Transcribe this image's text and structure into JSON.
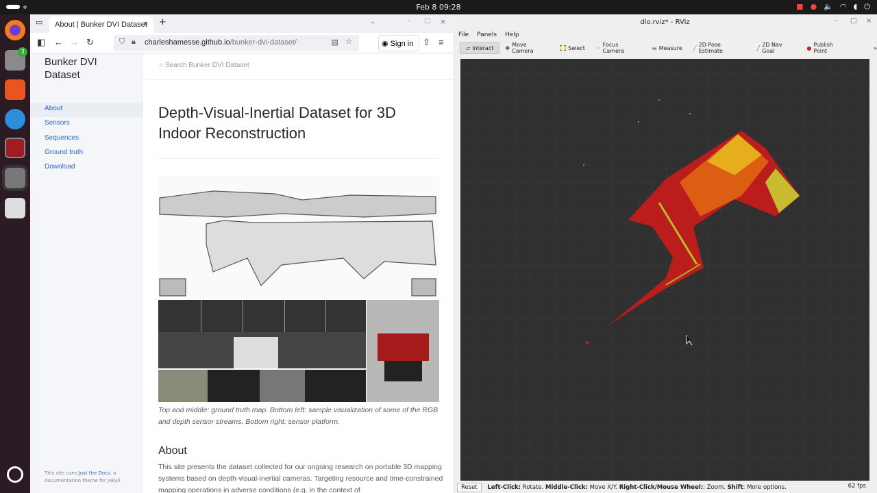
{
  "topbar": {
    "clock": "Feb 8  09:28"
  },
  "dock": {
    "files_badge": "3"
  },
  "browser": {
    "tab_title": "About | Bunker DVI Dataset",
    "url_host": "charleshamesse.github.io",
    "url_path": "/bunker-dvi-dataset/",
    "sign_in": "Sign in",
    "site_title": "Bunker DVI Dataset",
    "nav": [
      {
        "label": "About"
      },
      {
        "label": "Sensors"
      },
      {
        "label": "Sequences"
      },
      {
        "label": "Ground truth"
      },
      {
        "label": "Download"
      }
    ],
    "footer_prefix": "This site uses ",
    "footer_link": "Just the Docs",
    "footer_suffix": ", a documentation theme for Jekyll.",
    "search_placeholder": "Search Bunker DVI Dataset",
    "heading": "Depth-Visual-Inertial Dataset for 3D Indoor Reconstruction",
    "caption": "Top and middle: ground truth map. Bottom left: sample visualization of some of the RGB and depth sensor streams. Bottom right: sensor platform.",
    "section_heading": "About",
    "paragraph": "This site presents the dataset collected for our ongoing research on portable 3D mapping systems based on depth-visual-inertial cameras. Targeting resource and time-constrained mapping operations in adverse conditions (e.g. in the context of"
  },
  "rviz": {
    "title": "dlo.rviz* - RViz",
    "menu": [
      "File",
      "Panels",
      "Help"
    ],
    "tools": [
      "Interact",
      "Move Camera",
      "Select",
      "Focus Camera",
      "Measure",
      "2D Pose Estimate",
      "2D Nav Goal",
      "Publish Point"
    ],
    "reset": "Reset",
    "hint_b1": "Left-Click:",
    "hint_t1": " Rotate. ",
    "hint_b2": "Middle-Click:",
    "hint_t2": " Move X/Y. ",
    "hint_b3": "Right-Click/Mouse Wheel:",
    "hint_t3": ": Zoom. ",
    "hint_b4": "Shift",
    "hint_t4": ": More options.",
    "fps": "62 fps"
  }
}
